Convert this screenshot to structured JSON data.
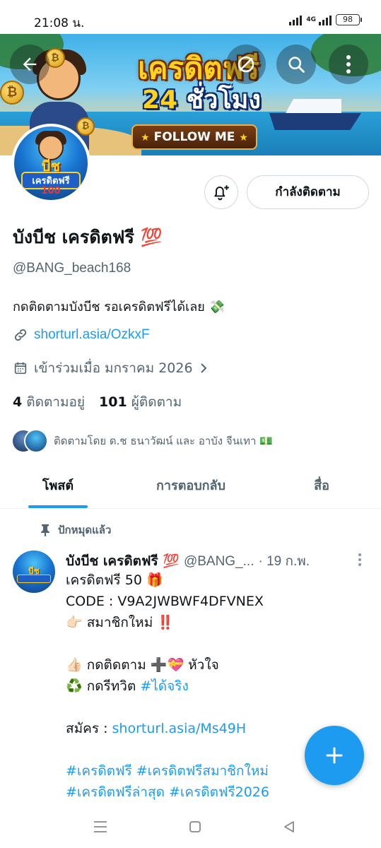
{
  "status_bar": {
    "time": "21:08 น.",
    "network": "4G",
    "battery": "98"
  },
  "banner": {
    "title": "เครดิตฟรี",
    "subtitle_number": "24",
    "subtitle_text": "ชั่วโมง",
    "follow_label": "FOLLOW ME",
    "coin_symbol": "₿"
  },
  "header_actions": {
    "back_icon": "arrow-left-icon",
    "mute_icon": "circle-slash-icon",
    "search_icon": "search-icon",
    "more_icon": "more-vertical-icon"
  },
  "avatar": {
    "logo_top": "บีช",
    "logo_mid": "เครดิตฟรี",
    "logo_bot": "100"
  },
  "profile": {
    "display_name": "บังบีช เครดิตฟรี 💯",
    "handle": "@BANG_beach168",
    "bio": "กดติดตามบังบีช รอเครดิตฟรีได้เลย 💸",
    "link": "shorturl.asia/OzkxF",
    "joined": "เข้าร่วมเมื่อ มกราคม 2026",
    "following_count": "4",
    "following_label": "ติดตามอยู่",
    "followers_count": "101",
    "followers_label": "ผู้ติดตาม",
    "followed_by": "ติดตามโดย ด.ช ธนาวัฒน์ และ อาบัง จีนเทา 💵",
    "following_button": "กำลังติดตาม"
  },
  "tabs": [
    {
      "label": "โพสต์",
      "active": true
    },
    {
      "label": "การตอบกลับ",
      "active": false
    },
    {
      "label": "สื่อ",
      "active": false
    }
  ],
  "post": {
    "pinned_label": "ปักหมุดแล้ว",
    "author": "บังบีช เครดิตฟรี 💯",
    "handle": "@BANG_...",
    "date": "· 19 ก.พ.",
    "line1": "เครดิตฟรี 50 🎁",
    "line2": "CODE : V9A2JWBWF4DFVNEX",
    "line3": "👉🏻 สมาชิกใหม่ ‼️",
    "line4": "👍🏻 กดติดตาม ➕💝 หัวใจ",
    "line5_prefix": "♻️ กดรีทวิต ",
    "line5_tag": "#ได้จริง",
    "line6_prefix": "สมัคร : ",
    "line6_link": "shorturl.asia/Ms49H",
    "line7": "#เครดิตฟรี #เครดิตฟรีสมาชิกใหม่",
    "line8": "#เครดิตฟรีล่าสุด #เครดิตฟรี2026"
  },
  "colors": {
    "accent": "#1d9bf0",
    "text": "#0f1419",
    "secondary": "#536471",
    "border": "#cfd9de"
  }
}
